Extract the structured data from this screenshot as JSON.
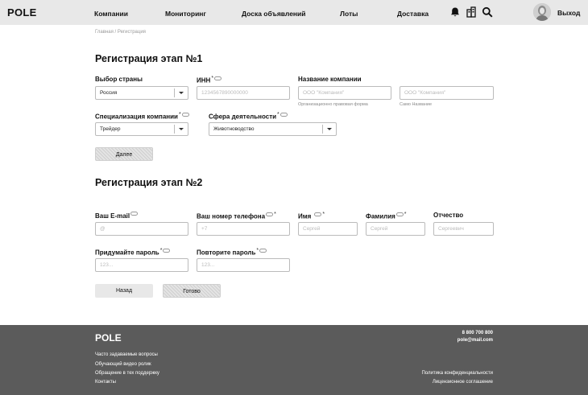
{
  "header": {
    "logo": "POLE",
    "nav": [
      "Компании",
      "Мониторинг",
      "Доска объявлений",
      "Лоты",
      "Доставка"
    ],
    "logout": "Выход"
  },
  "breadcrumb": {
    "home": "Главная",
    "separator": " / ",
    "current": "Регистрация"
  },
  "step1": {
    "title": "Регистрация этап №1",
    "country": {
      "label": "Выбор страны",
      "value": "Россия"
    },
    "inn": {
      "label": "ИНН",
      "placeholder": "1234567890000000"
    },
    "company": {
      "label": "Название компании",
      "form_placeholder": "ООО \"Компания\"",
      "form_hint": "Организационно правовая форма",
      "name_placeholder": "ООО \"Компания\"",
      "name_hint": "Само Название"
    },
    "specialization": {
      "label": "Специализация компании",
      "value": "Трейдер"
    },
    "sphere": {
      "label": "Сфера деятельности",
      "value": "Животноводство"
    },
    "next_button": "Далее"
  },
  "step2": {
    "title": "Регистрация этап №2",
    "email": {
      "label": "Ваш E-mail",
      "placeholder": "@"
    },
    "phone": {
      "label": "Ваш номер телефона",
      "placeholder": "+7"
    },
    "first_name": {
      "label": "Имя",
      "placeholder": "Сергей"
    },
    "last_name": {
      "label": "Фамилия",
      "placeholder": "Сергей"
    },
    "patronymic": {
      "label": "Отчество",
      "placeholder": "Сергеевич"
    },
    "password": {
      "label": "Придумайте пароль",
      "placeholder": "123..."
    },
    "password_repeat": {
      "label": "Повторите пароль",
      "placeholder": "123..."
    },
    "back_button": "Назад",
    "done_button": "Готово"
  },
  "required_mark": "*",
  "footer": {
    "logo": "POLE",
    "links": [
      "Часто задаваемые вопросы",
      "Обучающий видео ролик",
      "Обращение в тех поддержку",
      "Контакты"
    ],
    "phone": "8 800 700 800",
    "email": "pole@mail.com",
    "privacy": "Политика конфиденциальности",
    "license": "Лицензионное соглашение"
  }
}
